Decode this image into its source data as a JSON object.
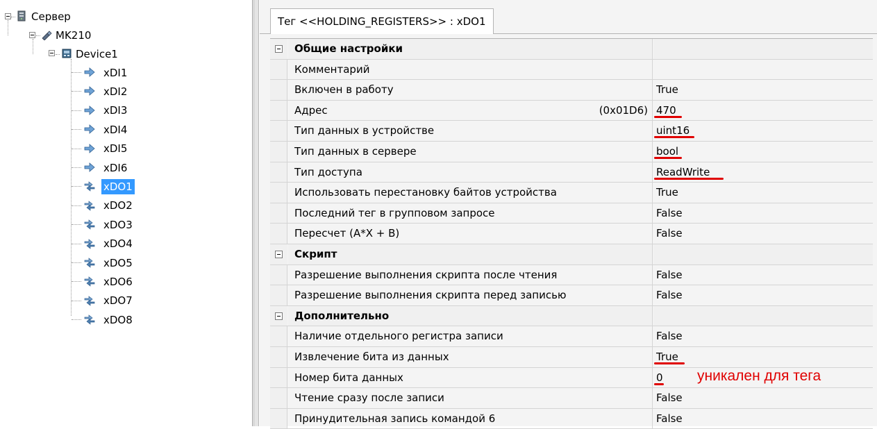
{
  "tree": {
    "root": "Сервер",
    "controller": "MK210",
    "device": "Device1",
    "items": [
      {
        "label": "xDI1",
        "kind": "input"
      },
      {
        "label": "xDI2",
        "kind": "input"
      },
      {
        "label": "xDI3",
        "kind": "input"
      },
      {
        "label": "xDI4",
        "kind": "input"
      },
      {
        "label": "xDI5",
        "kind": "input"
      },
      {
        "label": "xDI6",
        "kind": "input"
      },
      {
        "label": "xDO1",
        "kind": "output",
        "selected": true
      },
      {
        "label": "xDO2",
        "kind": "output"
      },
      {
        "label": "xDO3",
        "kind": "output"
      },
      {
        "label": "xDO4",
        "kind": "output"
      },
      {
        "label": "xDO5",
        "kind": "output"
      },
      {
        "label": "xDO6",
        "kind": "output"
      },
      {
        "label": "xDO7",
        "kind": "output"
      },
      {
        "label": "xDO8",
        "kind": "output"
      }
    ]
  },
  "tab": {
    "label": "Тег  <<HOLDING_REGISTERS>> : xDO1"
  },
  "properties": {
    "rows": [
      {
        "type": "category",
        "name": "Общие настройки"
      },
      {
        "type": "prop",
        "name": "Комментарий",
        "value": ""
      },
      {
        "type": "prop",
        "name": "Включен в работу",
        "value": "True"
      },
      {
        "type": "prop",
        "name": "Адрес",
        "hex": "(0x01D6)",
        "value": "470",
        "underline": true
      },
      {
        "type": "prop",
        "name": "Тип данных в устройстве",
        "value": "uint16",
        "underline": true
      },
      {
        "type": "prop",
        "name": "Тип данных в сервере",
        "value": "bool",
        "underline": true
      },
      {
        "type": "prop",
        "name": "Тип доступа",
        "value": "ReadWrite",
        "underline": true
      },
      {
        "type": "prop",
        "name": "Использовать перестановку байтов устройства",
        "value": "True"
      },
      {
        "type": "prop",
        "name": "Последний тег в групповом запросе",
        "value": "False"
      },
      {
        "type": "prop",
        "name": "Пересчет (A*X + B)",
        "value": "False"
      },
      {
        "type": "category",
        "name": "Скрипт"
      },
      {
        "type": "prop",
        "name": "Разрешение выполнения скрипта после чтения",
        "value": "False"
      },
      {
        "type": "prop",
        "name": "Разрешение выполнения скрипта перед записью",
        "value": "False"
      },
      {
        "type": "category",
        "name": "Дополнительно"
      },
      {
        "type": "prop",
        "name": "Наличие отдельного регистра записи",
        "value": "False"
      },
      {
        "type": "prop",
        "name": "Извлечение бита из данных",
        "value": "True",
        "underline": true
      },
      {
        "type": "prop",
        "name": "Номер бита данных",
        "value": "0",
        "underline": true
      },
      {
        "type": "prop",
        "name": "Чтение сразу после записи",
        "value": "False"
      },
      {
        "type": "prop",
        "name": "Принудительная запись командой 6",
        "value": "False"
      }
    ]
  },
  "annotation": {
    "text": "уникален для тега"
  },
  "colors": {
    "selection": "#3399ff",
    "annotation": "#e00000"
  }
}
